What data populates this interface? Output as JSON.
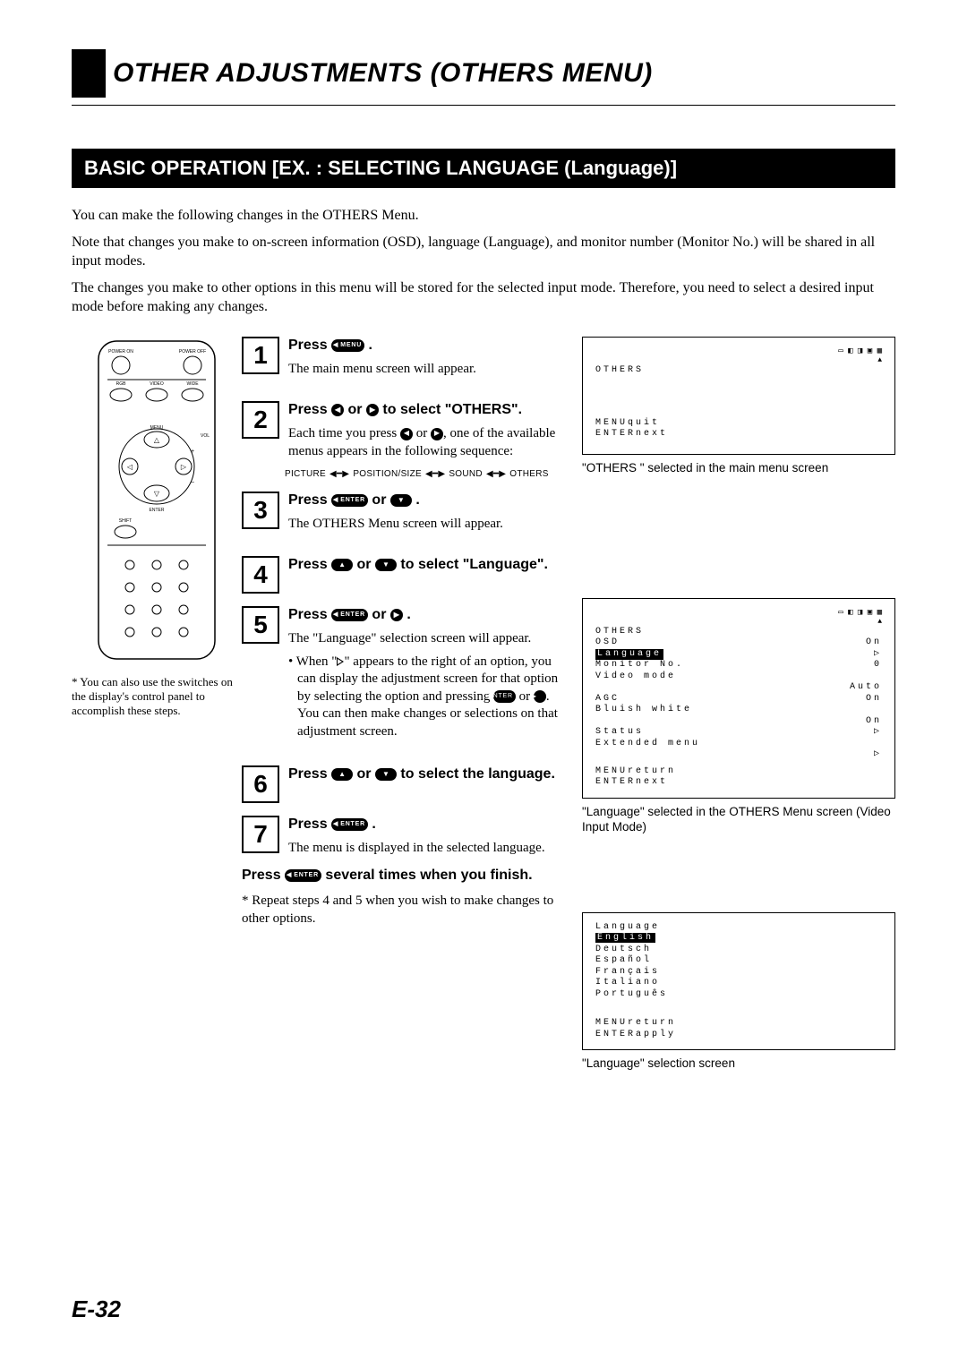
{
  "page": {
    "title": "OTHER ADJUSTMENTS (OTHERS MENU)",
    "banner": "BASIC OPERATION [EX. : SELECTING LANGUAGE (Language)]",
    "intro1": "You can make the following changes in the OTHERS Menu.",
    "intro2": "Note that changes you make to on-screen information (OSD), language (Language), and monitor number (Monitor No.) will be shared in all input modes.",
    "intro3": "The changes you make to other options in this menu will be stored for the selected input mode.  Therefore, you need to select a desired input mode before making any changes.",
    "page_number": "E-32"
  },
  "remote": {
    "note": "* You can also use the switches on the display's control panel to accomplish these steps.",
    "labels": {
      "power_on": "POWER ON",
      "power_off": "POWER OFF",
      "rgb": "RGB",
      "video": "VIDEO",
      "wide": "WIDE",
      "menu": "MENU",
      "vol": "VOL",
      "enter": "ENTER",
      "shift": "SHIFT"
    }
  },
  "buttons": {
    "menu": "MENU",
    "enter": "ENTER"
  },
  "steps": [
    {
      "num": "1",
      "head_pre": "Press ",
      "head_post": ".",
      "desc": "The main menu screen will appear."
    },
    {
      "num": "2",
      "head_pre": "Press ",
      "head_mid": " or ",
      "head_post": " to select \"OTHERS\".",
      "desc_pre": "Each time you press ",
      "desc_mid": " or ",
      "desc_post": ", one of the available menus appears in the following sequence:"
    },
    {
      "num": "3",
      "head_pre": "Press ",
      "head_mid": " or ",
      "head_post": ".",
      "desc": "The OTHERS Menu screen will appear."
    },
    {
      "num": "4",
      "head_pre": "Press ",
      "head_mid": " or ",
      "head_post": " to select \"Language\"."
    },
    {
      "num": "5",
      "head_pre": "Press ",
      "head_mid": " or ",
      "head_post": ".",
      "desc": "The \"Language\" selection screen will appear.",
      "bullet_a": "When \"",
      "bullet_b": "\" appears to the right of an option, you can display the adjustment screen for that option by selecting the option and pressing ",
      "bullet_c": " or ",
      "bullet_d": ". You can then make changes or selections on that adjustment screen."
    },
    {
      "num": "6",
      "head_pre": "Press ",
      "head_mid": " or ",
      "head_post": " to select the language."
    },
    {
      "num": "7",
      "head_pre": "Press ",
      "head_post": ".",
      "desc": "The menu is displayed in the selected language."
    }
  ],
  "sequence": [
    "PICTURE",
    "POSITION/SIZE",
    "SOUND",
    "OTHERS"
  ],
  "final": {
    "head_pre": "Press ",
    "head_post": " several times when you finish.",
    "note": "* Repeat steps 4 and 5 when you wish to make changes to other options."
  },
  "screens": {
    "s1": {
      "top_icons": "▭ ◧ ◨ ▣ ▦",
      "title": "OTHERS",
      "quit": "MENUquit",
      "next": "ENTERnext",
      "caption": "\"OTHERS \" selected in the main menu screen"
    },
    "s2": {
      "top_icons": "▭ ◧ ◨ ▣ ▦",
      "title": "OTHERS",
      "rows": [
        {
          "l": "OSD",
          "r": "On"
        },
        {
          "l_hl": "Language",
          "r": "▷"
        },
        {
          "l": "Monitor No.",
          "r": "0"
        },
        {
          "l": "Video mode",
          "r": ""
        },
        {
          "l": "",
          "r": "Auto"
        },
        {
          "l": "AGC",
          "r": "On"
        },
        {
          "l": "Bluish white",
          "r": ""
        },
        {
          "l": "",
          "r": "On"
        },
        {
          "l": "Status",
          "r": "▷"
        },
        {
          "l": "Extended menu",
          "r": ""
        },
        {
          "l": "",
          "r": "▷"
        }
      ],
      "ret": "MENUreturn",
      "next": "ENTERnext",
      "caption": "\"Language\" selected in the OTHERS Menu screen (Video Input Mode)"
    },
    "s3": {
      "lines": [
        "Language",
        "English",
        "Deutsch",
        "Español",
        "Français",
        "Italiano",
        "Português"
      ],
      "highlight_index": 1,
      "ret": "MENUreturn",
      "apply": "ENTERapply",
      "caption": "\"Language\" selection screen"
    }
  }
}
